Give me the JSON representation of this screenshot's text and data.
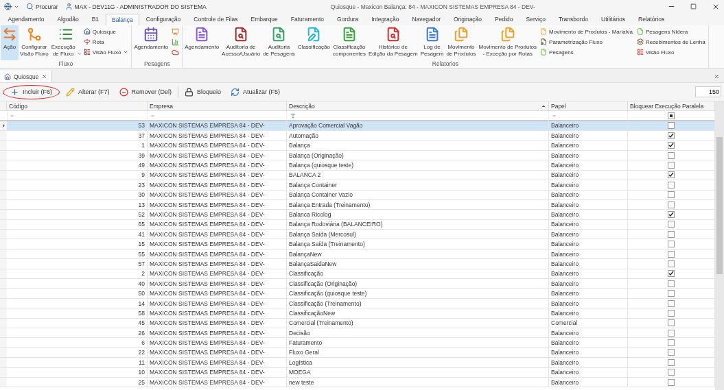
{
  "title_bar": {
    "search": "Procurar",
    "user": "MAX - DEV11G - ADMINISTRADOR DO SISTEMA",
    "title": "Quiosque - Maxicon Balança: 84 - MAXICON SISTEMAS EMPRESA 84 - DEV-"
  },
  "ribbon_tabs": [
    {
      "label": "Agendamento",
      "selected": false
    },
    {
      "label": "Algodão",
      "selected": false
    },
    {
      "label": "B1",
      "selected": false
    },
    {
      "label": "Balança",
      "selected": true
    },
    {
      "label": "Configuração",
      "selected": false
    },
    {
      "label": "Controle de Filas",
      "selected": false
    },
    {
      "label": "Embarque",
      "selected": false
    },
    {
      "label": "Faturamento",
      "selected": false
    },
    {
      "label": "Gordura",
      "selected": false
    },
    {
      "label": "Integração",
      "selected": false
    },
    {
      "label": "Navegador",
      "selected": false
    },
    {
      "label": "Originação",
      "selected": false
    },
    {
      "label": "Pedido",
      "selected": false
    },
    {
      "label": "Serviço",
      "selected": false
    },
    {
      "label": "Transbordo",
      "selected": false
    },
    {
      "label": "Utilitários",
      "selected": false
    },
    {
      "label": "Relatórios",
      "selected": false
    }
  ],
  "ribbon_groups": [
    {
      "label": "Fluxo",
      "large": [
        {
          "label": "Ação",
          "kind": "arrows",
          "selected": true
        },
        {
          "label": "Configurar\nVisão Fluxo",
          "kind": "flow",
          "selected": false
        },
        {
          "label": "Execução\nde Fluxo",
          "kind": "list",
          "selected": false,
          "dropdown": true
        }
      ],
      "small_columns": [
        [
          {
            "label": "Quiosque",
            "kind": "kiosk"
          },
          {
            "label": "Rota",
            "kind": "route"
          },
          {
            "label": "Visão Fluxo",
            "kind": "flowview",
            "dropdown": true
          }
        ]
      ]
    },
    {
      "label": "Pesagens",
      "large": [
        {
          "label": "Agendamento",
          "kind": "calendar",
          "selected": false
        }
      ],
      "small_columns": [
        [
          {
            "kind": "easel"
          },
          {
            "kind": "chart"
          },
          {
            "kind": "cloud"
          }
        ]
      ]
    },
    {
      "label": "Relatorios",
      "large": [
        {
          "label": "Agendamento",
          "kind": "doc-purple",
          "selected": false
        },
        {
          "label": "Auditoria de\nAcesso/Usuário",
          "kind": "audit",
          "selected": false
        },
        {
          "label": "Auditoria\nde Pesagens",
          "kind": "audit-green",
          "selected": false
        },
        {
          "label": "Classificação",
          "kind": "class",
          "selected": false
        },
        {
          "label": "Classificação\ncomponentes",
          "kind": "doc-green",
          "selected": false
        },
        {
          "label": "Histórico de\nEdição da Pesagem",
          "kind": "history",
          "selected": false
        },
        {
          "label": "Log de\nPesagem",
          "kind": "log",
          "selected": false
        },
        {
          "label": "Movimento\nde Produtos",
          "kind": "move",
          "selected": false
        },
        {
          "label": "Movimento de Produtos\n- Exceção por Rotas",
          "kind": "move",
          "selected": false
        }
      ],
      "small_columns": [
        [
          {
            "label": "Movimento de Produtos - Marialva",
            "kind": "doc-orange"
          },
          {
            "label": "Parametrização Fluxo",
            "kind": "gear-doc"
          },
          {
            "label": "Pesagens",
            "kind": "doc-lime"
          }
        ],
        [
          {
            "label": "Pesagens Nidera",
            "kind": "doc-lime"
          },
          {
            "label": "Recebimentos de Lenha",
            "kind": "wood"
          },
          {
            "label": "Visão Fluxo",
            "kind": "red-list"
          }
        ]
      ]
    }
  ],
  "document_tab": {
    "label": "Quiosque",
    "selected": true
  },
  "toolbar": [
    {
      "label": "Incluir (F6)",
      "kind": "add",
      "highlighted": true
    },
    {
      "label": "Alterar (F7)",
      "kind": "edit",
      "highlighted": false
    },
    {
      "label": "Remover (Del)",
      "kind": "remove",
      "highlighted": false
    },
    {
      "label": "Bloqueio",
      "kind": "lock",
      "highlighted": false
    },
    {
      "label": "Atualizar (F5)",
      "kind": "refresh",
      "highlighted": false
    }
  ],
  "page_size": "150",
  "table": {
    "columns": [
      {
        "label": "Código",
        "sorted_ascending": false
      },
      {
        "label": "Empresa",
        "sorted_ascending": false
      },
      {
        "label": "Descrição",
        "sorted_ascending": true
      },
      {
        "label": "Papel",
        "sorted_ascending": false
      },
      {
        "label": "Bloquear Execução Paralela",
        "sorted_ascending": false
      }
    ],
    "filter_row": [
      {
        "kind": "text",
        "value": "="
      },
      {
        "kind": "text",
        "value": "="
      },
      {
        "kind": "icon"
      },
      {
        "kind": "text",
        "value": "="
      },
      {
        "kind": "checkbox",
        "indeterminate": true
      }
    ],
    "rows": [
      {
        "codigo": "53",
        "empresa": "MAXICON SISTEMAS EMPRESA 84 - DEV-",
        "descricao": "Aprovação Comercial Vagão",
        "papel": "Balanceiro",
        "bloquear": false,
        "selected": true
      },
      {
        "codigo": "37",
        "empresa": "MAXICON SISTEMAS EMPRESA 84 - DEV-",
        "descricao": "Automação",
        "papel": "Balanceiro",
        "bloquear": true,
        "selected": false
      },
      {
        "codigo": "1",
        "empresa": "MAXICON SISTEMAS EMPRESA 84 - DEV-",
        "descricao": "Balança",
        "papel": "Balanceiro",
        "bloquear": true,
        "selected": false
      },
      {
        "codigo": "39",
        "empresa": "MAXICON SISTEMAS EMPRESA 84 - DEV-",
        "descricao": "Balança (Originação)",
        "papel": "Balanceiro",
        "bloquear": false,
        "selected": false
      },
      {
        "codigo": "49",
        "empresa": "MAXICON SISTEMAS EMPRESA 84 - DEV-",
        "descricao": "Balança (quiosque teste)",
        "papel": "Balanceiro",
        "bloquear": false,
        "selected": false
      },
      {
        "codigo": "9",
        "empresa": "MAXICON SISTEMAS EMPRESA 84 - DEV-",
        "descricao": "BALANCA 2",
        "papel": "Balanceiro",
        "bloquear": true,
        "selected": false
      },
      {
        "codigo": "23",
        "empresa": "MAXICON SISTEMAS EMPRESA 84 - DEV-",
        "descricao": "Balança Container",
        "papel": "Balanceiro",
        "bloquear": false,
        "selected": false
      },
      {
        "codigo": "30",
        "empresa": "MAXICON SISTEMAS EMPRESA 84 - DEV-",
        "descricao": "Balança Container Vazio",
        "papel": "Balanceiro",
        "bloquear": false,
        "selected": false
      },
      {
        "codigo": "13",
        "empresa": "MAXICON SISTEMAS EMPRESA 84 - DEV-",
        "descricao": "Balança Entrada (Treinamento)",
        "papel": "Balanceiro",
        "bloquear": false,
        "selected": false
      },
      {
        "codigo": "52",
        "empresa": "MAXICON SISTEMAS EMPRESA 84 - DEV-",
        "descricao": "Balanca Ricolog",
        "papel": "Balanceiro",
        "bloquear": true,
        "selected": false
      },
      {
        "codigo": "65",
        "empresa": "MAXICON SISTEMAS EMPRESA 84 - DEV-",
        "descricao": "Balança Rodoviária (BALANCEIRO)",
        "papel": "Balanceiro",
        "bloquear": false,
        "selected": false
      },
      {
        "codigo": "41",
        "empresa": "MAXICON SISTEMAS EMPRESA 84 - DEV-",
        "descricao": "Balança Saída (Mercosul)",
        "papel": "Balanceiro",
        "bloquear": false,
        "selected": false
      },
      {
        "codigo": "15",
        "empresa": "MAXICON SISTEMAS EMPRESA 84 - DEV-",
        "descricao": "Balança Saída (Treinamento)",
        "papel": "Balanceiro",
        "bloquear": false,
        "selected": false
      },
      {
        "codigo": "55",
        "empresa": "MAXICON SISTEMAS EMPRESA 84 - DEV-",
        "descricao": "BalançaNew",
        "papel": "Balanceiro",
        "bloquear": false,
        "selected": false
      },
      {
        "codigo": "57",
        "empresa": "MAXICON SISTEMAS EMPRESA 84 - DEV-",
        "descricao": "BalançaSaidaNew",
        "papel": "Balanceiro",
        "bloquear": false,
        "selected": false
      },
      {
        "codigo": "2",
        "empresa": "MAXICON SISTEMAS EMPRESA 84 - DEV-",
        "descricao": "Classificação",
        "papel": "Balanceiro",
        "bloquear": true,
        "selected": false
      },
      {
        "codigo": "40",
        "empresa": "MAXICON SISTEMAS EMPRESA 84 - DEV-",
        "descricao": "Classificação (Originação)",
        "papel": "Balanceiro",
        "bloquear": false,
        "selected": false
      },
      {
        "codigo": "50",
        "empresa": "MAXICON SISTEMAS EMPRESA 84 - DEV-",
        "descricao": "Classificação (quiosque teste)",
        "papel": "Balanceiro",
        "bloquear": false,
        "selected": false
      },
      {
        "codigo": "14",
        "empresa": "MAXICON SISTEMAS EMPRESA 84 - DEV-",
        "descricao": "Classificação (Treinamento)",
        "papel": "Balanceiro",
        "bloquear": false,
        "selected": false
      },
      {
        "codigo": "58",
        "empresa": "MAXICON SISTEMAS EMPRESA 84 - DEV-",
        "descricao": "ClassificaçãoNew",
        "papel": "Balanceiro",
        "bloquear": false,
        "selected": false
      },
      {
        "codigo": "45",
        "empresa": "MAXICON SISTEMAS EMPRESA 84 - DEV-",
        "descricao": "Comercial (Treinamento)",
        "papel": "Comercial",
        "bloquear": false,
        "selected": false
      },
      {
        "codigo": "26",
        "empresa": "MAXICON SISTEMAS EMPRESA 84 - DEV-",
        "descricao": "Decisão",
        "papel": "Balanceiro",
        "bloquear": false,
        "selected": false
      },
      {
        "codigo": "6",
        "empresa": "MAXICON SISTEMAS EMPRESA 84 - DEV-",
        "descricao": "Faturamento",
        "papel": "Balanceiro",
        "bloquear": false,
        "selected": false
      },
      {
        "codigo": "22",
        "empresa": "MAXICON SISTEMAS EMPRESA 84 - DEV-",
        "descricao": "Fluxo Geral",
        "papel": "Balanceiro",
        "bloquear": false,
        "selected": false
      },
      {
        "codigo": "11",
        "empresa": "MAXICON SISTEMAS EMPRESA 84 - DEV-",
        "descricao": "Logística",
        "papel": "Balanceiro",
        "bloquear": false,
        "selected": false
      },
      {
        "codigo": "10",
        "empresa": "MAXICON SISTEMAS EMPRESA 84 - DEV-",
        "descricao": "MOEGA",
        "papel": "Balanceiro",
        "bloquear": false,
        "selected": false
      },
      {
        "codigo": "25",
        "empresa": "MAXICON SISTEMAS EMPRESA 84 - DEV-",
        "descricao": "new teste",
        "papel": "Balanceiro",
        "bloquear": false,
        "selected": false
      }
    ]
  }
}
